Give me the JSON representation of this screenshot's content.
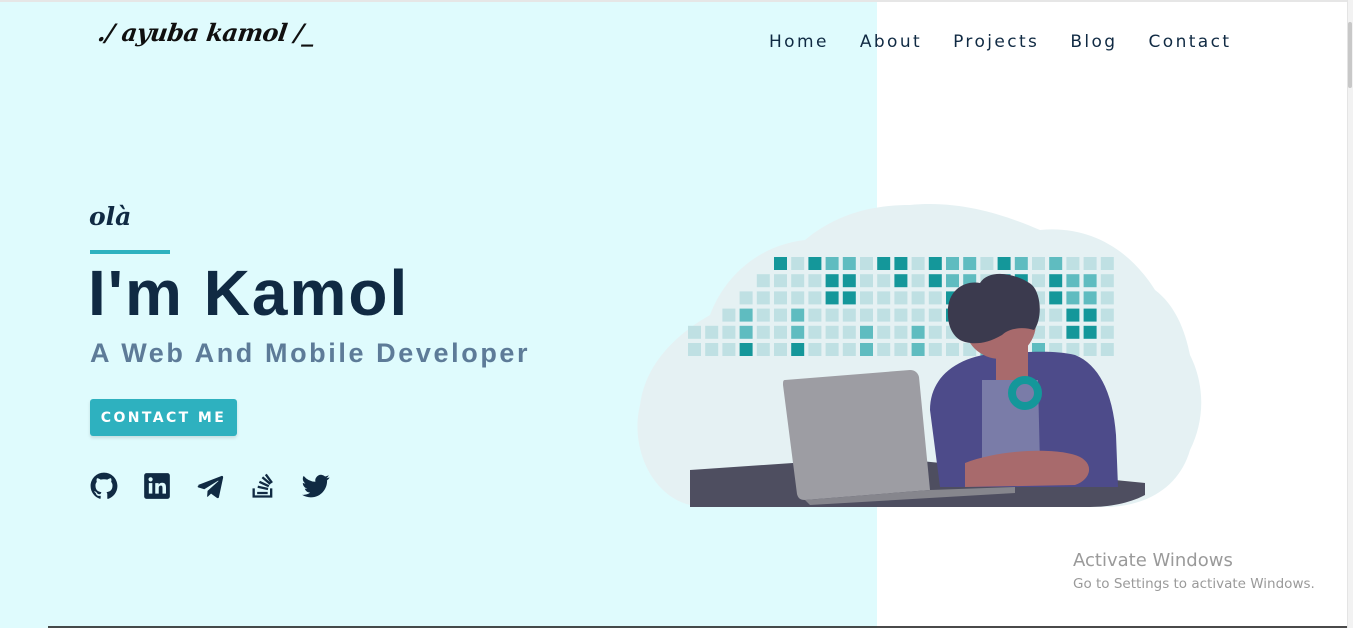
{
  "header": {
    "logo_text": "./ ayuba kamol /_",
    "nav": [
      "Home",
      "About",
      "Projects",
      "Blog",
      "Contact"
    ]
  },
  "hero": {
    "greeting": "olà",
    "title": "I'm Kamol",
    "subtitle": "A Web And Mobile Developer",
    "cta_label": "CONTACT ME"
  },
  "socials": [
    {
      "name": "github-icon"
    },
    {
      "name": "linkedin-icon"
    },
    {
      "name": "telegram-icon"
    },
    {
      "name": "stackoverflow-icon"
    },
    {
      "name": "twitter-icon"
    }
  ],
  "watermark": {
    "title": "Activate Windows",
    "subtitle": "Go to Settings to activate Windows."
  },
  "colors": {
    "left_background": "#dffbfd",
    "accent": "#2eb1bf",
    "heading": "#102a43",
    "subheading": "#5d7b98",
    "tile_dark": "#14979a",
    "tile_mid": "#5fbcc0",
    "tile_light": "#bfe0e3"
  }
}
